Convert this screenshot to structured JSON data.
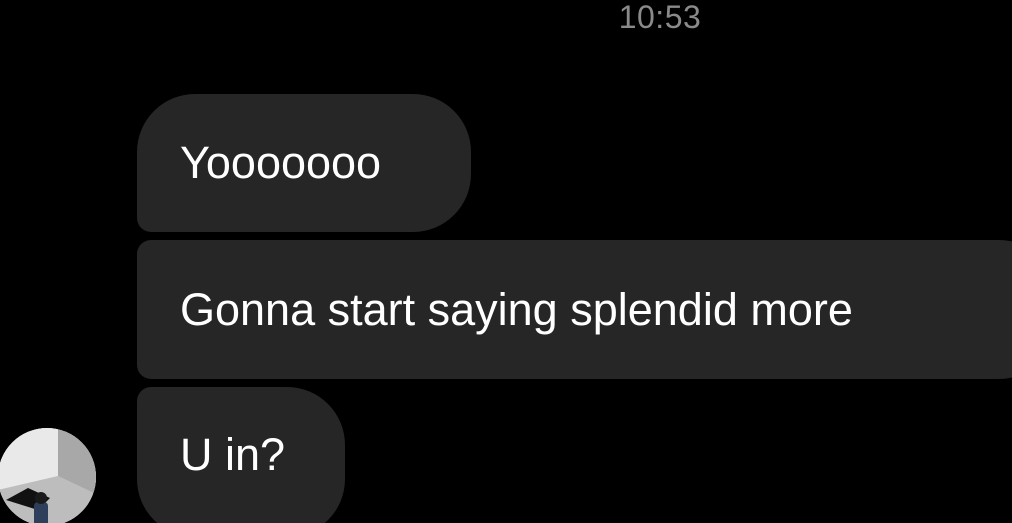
{
  "conversation": {
    "timestamp": "10:53",
    "messages": [
      {
        "text": "Yooooooo"
      },
      {
        "text": "Gonna start saying splendid more"
      },
      {
        "text": "U in?"
      }
    ]
  },
  "sender": {
    "avatar_icon": "profile-photo"
  },
  "colors": {
    "background": "#000000",
    "bubble": "#262626",
    "message_text": "#ffffff",
    "timestamp_text": "#8a8a8a"
  }
}
